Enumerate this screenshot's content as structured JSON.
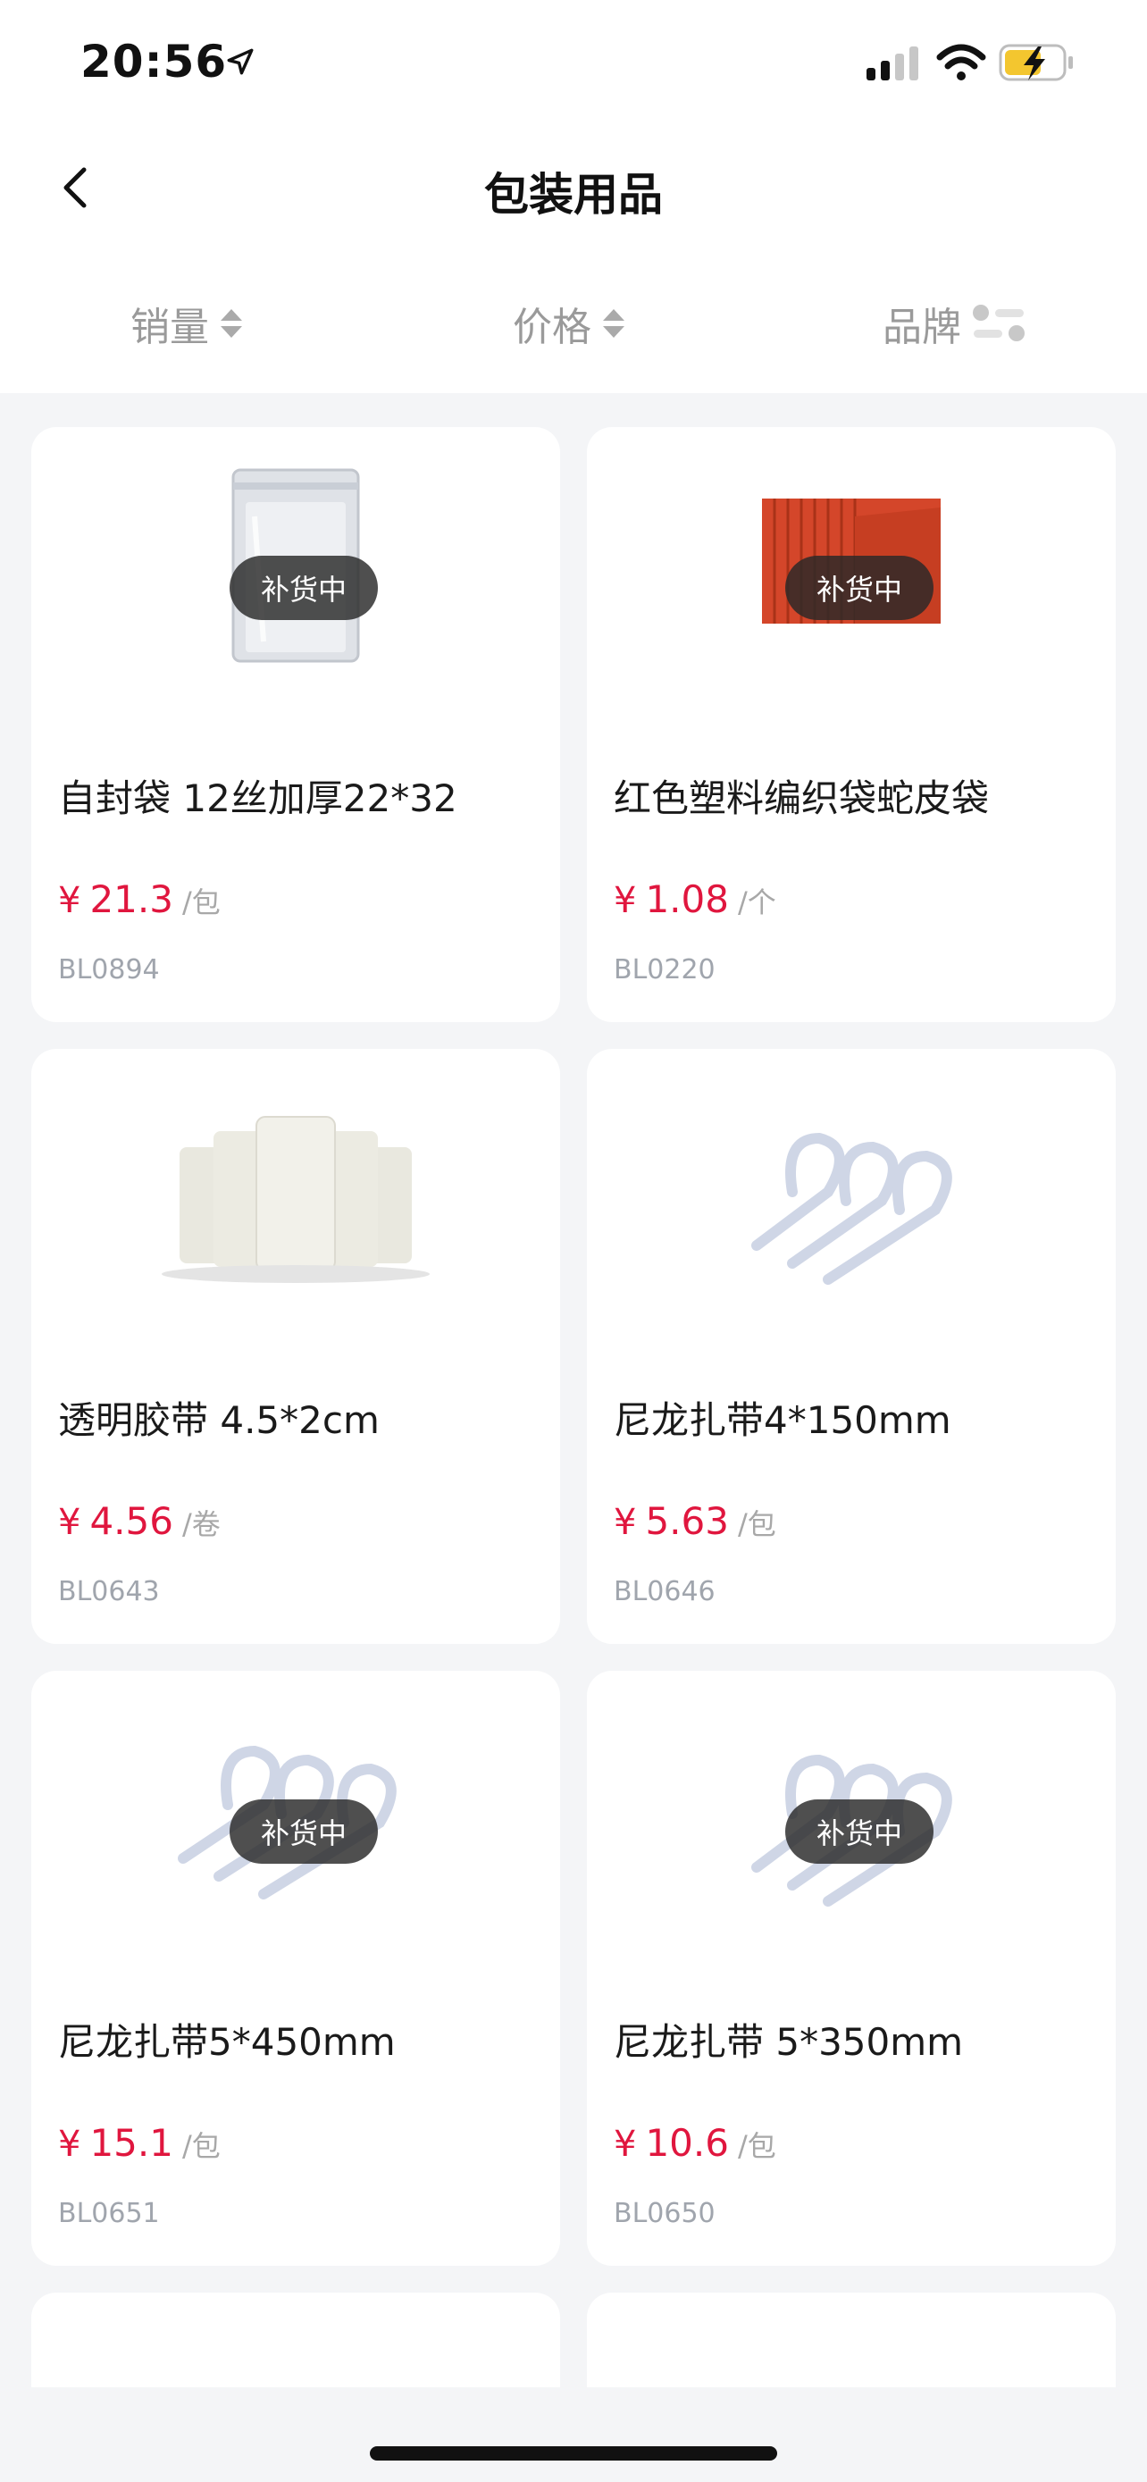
{
  "status": {
    "time": "20:56"
  },
  "nav": {
    "title": "包装用品"
  },
  "sort": {
    "sales": "销量",
    "price": "价格",
    "brand": "品牌"
  },
  "products": [
    {
      "name": "自封袋 12丝加厚22*32",
      "price": "21.3",
      "unit": "/包",
      "sku": "BL0894",
      "badge": "补货中"
    },
    {
      "name": "红色塑料编织袋蛇皮袋",
      "price": "1.08",
      "unit": "/个",
      "sku": "BL0220",
      "badge": "补货中"
    },
    {
      "name": "透明胶带 4.5*2cm",
      "price": "4.56",
      "unit": "/卷",
      "sku": "BL0643",
      "badge": ""
    },
    {
      "name": "尼龙扎带4*150mm",
      "price": "5.63",
      "unit": "/包",
      "sku": "BL0646",
      "badge": ""
    },
    {
      "name": "尼龙扎带5*450mm",
      "price": "15.1",
      "unit": "/包",
      "sku": "BL0651",
      "badge": "补货中"
    },
    {
      "name": "尼龙扎带 5*350mm",
      "price": "10.6",
      "unit": "/包",
      "sku": "BL0650",
      "badge": "补货中"
    }
  ],
  "currency": "¥",
  "colors": {
    "price": "#e0163e",
    "badge_bg": "#2a2a2a"
  }
}
